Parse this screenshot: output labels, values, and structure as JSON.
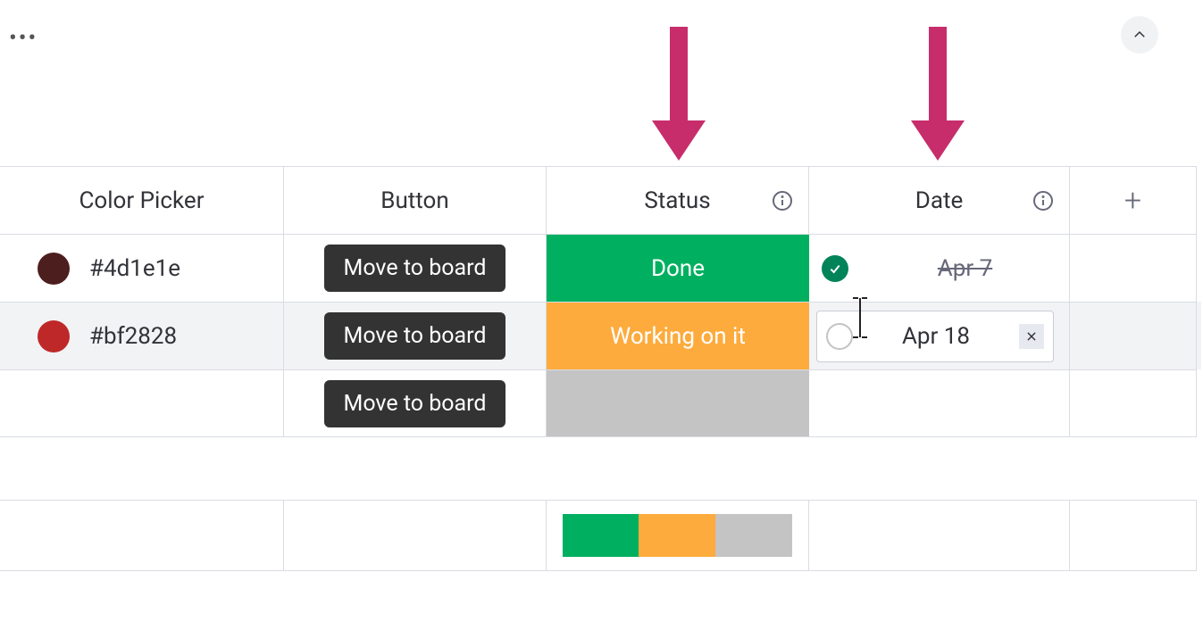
{
  "toolbar": {
    "more_label": "..."
  },
  "columns": {
    "color": "Color Picker",
    "button": "Button",
    "status": "Status",
    "date": "Date"
  },
  "rows": [
    {
      "swatch": "#4d1e1e",
      "hex": "#4d1e1e",
      "button": "Move to board",
      "status": {
        "label": "Done",
        "kind": "done",
        "bg": "#00b060"
      },
      "date": {
        "text": "Apr 7",
        "done": true,
        "editing": false
      }
    },
    {
      "swatch": "#bf2828",
      "hex": "#bf2828",
      "button": "Move to board",
      "status": {
        "label": "Working on it",
        "kind": "working",
        "bg": "#fdab3d"
      },
      "date": {
        "text": "Apr 18",
        "done": false,
        "editing": true
      }
    },
    {
      "swatch": "",
      "hex": "",
      "button": "Move to board",
      "status": {
        "label": "",
        "kind": "empty",
        "bg": "#c4c4c4"
      },
      "date": {
        "text": "",
        "done": false,
        "editing": false
      }
    }
  ],
  "summary": {
    "status_distribution": [
      {
        "kind": "done",
        "bg": "#00b060",
        "pct": 33.3
      },
      {
        "kind": "working",
        "bg": "#fdab3d",
        "pct": 33.3
      },
      {
        "kind": "empty",
        "bg": "#c4c4c4",
        "pct": 33.4
      }
    ]
  },
  "annotations": {
    "arrow_color": "#c72d6b"
  }
}
